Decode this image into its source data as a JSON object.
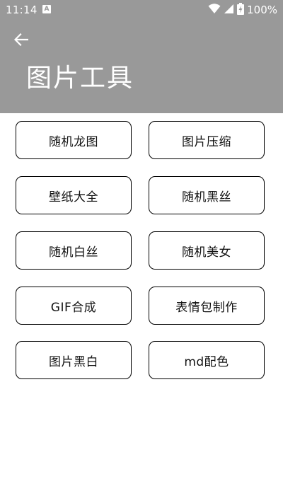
{
  "status_bar": {
    "time": "11:14",
    "notification_icon": "A",
    "battery_percent": "100%",
    "icons": [
      "wifi-icon",
      "signal-icon",
      "battery-charging-icon"
    ]
  },
  "app_bar": {
    "back_icon": "arrow-left",
    "title": "图片工具",
    "background_color": "#999999"
  },
  "tools": [
    {
      "label": "随机龙图"
    },
    {
      "label": "图片压缩"
    },
    {
      "label": "壁纸大全"
    },
    {
      "label": "随机黑丝"
    },
    {
      "label": "随机白丝"
    },
    {
      "label": "随机美女"
    },
    {
      "label": "GIF合成"
    },
    {
      "label": "表情包制作"
    },
    {
      "label": "图片黑白"
    },
    {
      "label": "md配色"
    }
  ]
}
